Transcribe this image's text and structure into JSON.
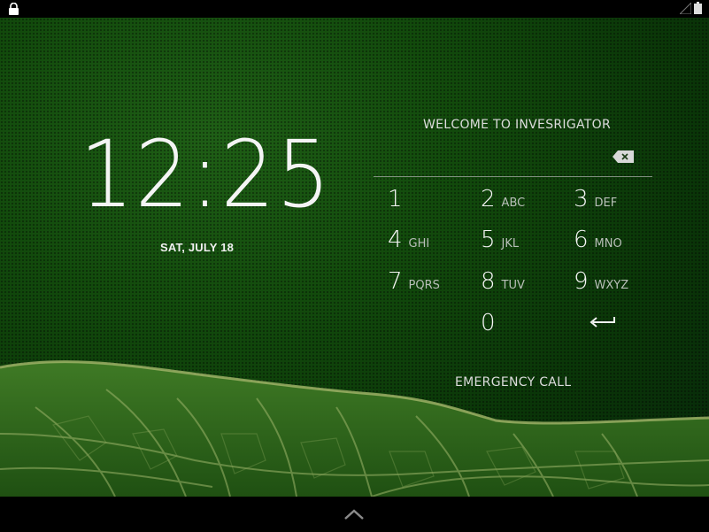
{
  "status_bar": {
    "left_icon": "lock-icon",
    "right_icons": [
      "signal-icon",
      "battery-icon"
    ]
  },
  "lockscreen": {
    "time": "12:25",
    "date": "SAT, JULY 18",
    "welcome": "WELCOME TO INVESRIGATOR",
    "pin_value": "",
    "emergency_label": "EMERGENCY CALL"
  },
  "keypad": {
    "k1": {
      "digit": "1",
      "letters": ""
    },
    "k2": {
      "digit": "2",
      "letters": "ABC"
    },
    "k3": {
      "digit": "3",
      "letters": "DEF"
    },
    "k4": {
      "digit": "4",
      "letters": "GHI"
    },
    "k5": {
      "digit": "5",
      "letters": "JKL"
    },
    "k6": {
      "digit": "6",
      "letters": "MNO"
    },
    "k7": {
      "digit": "7",
      "letters": "PQRS"
    },
    "k8": {
      "digit": "8",
      "letters": "TUV"
    },
    "k9": {
      "digit": "9",
      "letters": "WXYZ"
    },
    "k0": {
      "digit": "0",
      "letters": ""
    }
  },
  "icons": {
    "backspace": "backspace-icon",
    "enter": "enter-arrow-icon",
    "nav": "chevron-up-icon"
  },
  "colors": {
    "wallpaper_green": "#124a0c",
    "status_bar": "#000000",
    "text": "#f4f4f4"
  }
}
